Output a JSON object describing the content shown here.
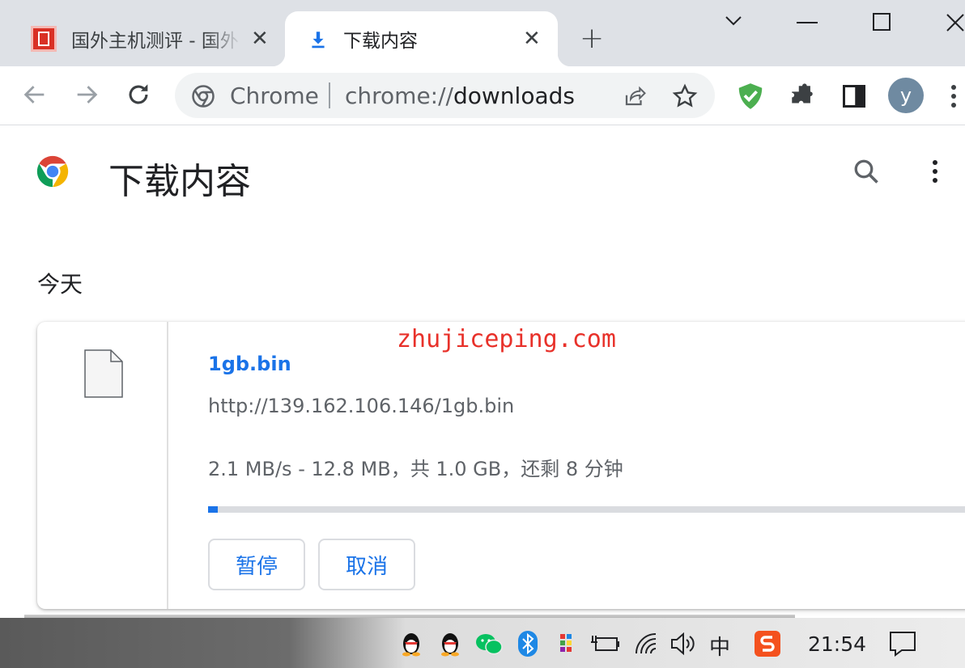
{
  "tabs": [
    {
      "title": "国外主机测评 - 国外",
      "close": "✕",
      "active": false
    },
    {
      "title": "下载内容",
      "close": "✕",
      "active": true
    }
  ],
  "new_tab": "+",
  "window_controls": {
    "dropdown": "⌵",
    "minimize": "—",
    "maximize": "☐",
    "close": "✕"
  },
  "omnibox": {
    "site_label": "Chrome",
    "url_scheme": "chrome://",
    "url_host": "downloads"
  },
  "profile_initial": "y",
  "page": {
    "title": "下载内容",
    "section": "今天"
  },
  "download": {
    "file_name": "1gb.bin",
    "url": "http://139.162.106.146/1gb.bin",
    "status": "2.1 MB/s - 12.8 MB，共 1.0 GB，还剩 8 分钟",
    "progress": 0.0125,
    "pause_label": "暂停",
    "cancel_label": "取消"
  },
  "watermark": "zhujiceping.com",
  "taskbar": {
    "ime": "中",
    "time": "21:54"
  },
  "colors": {
    "accent": "#1a73e8",
    "watermark": "#e8312a",
    "tab_strip": "#dee1e6"
  }
}
